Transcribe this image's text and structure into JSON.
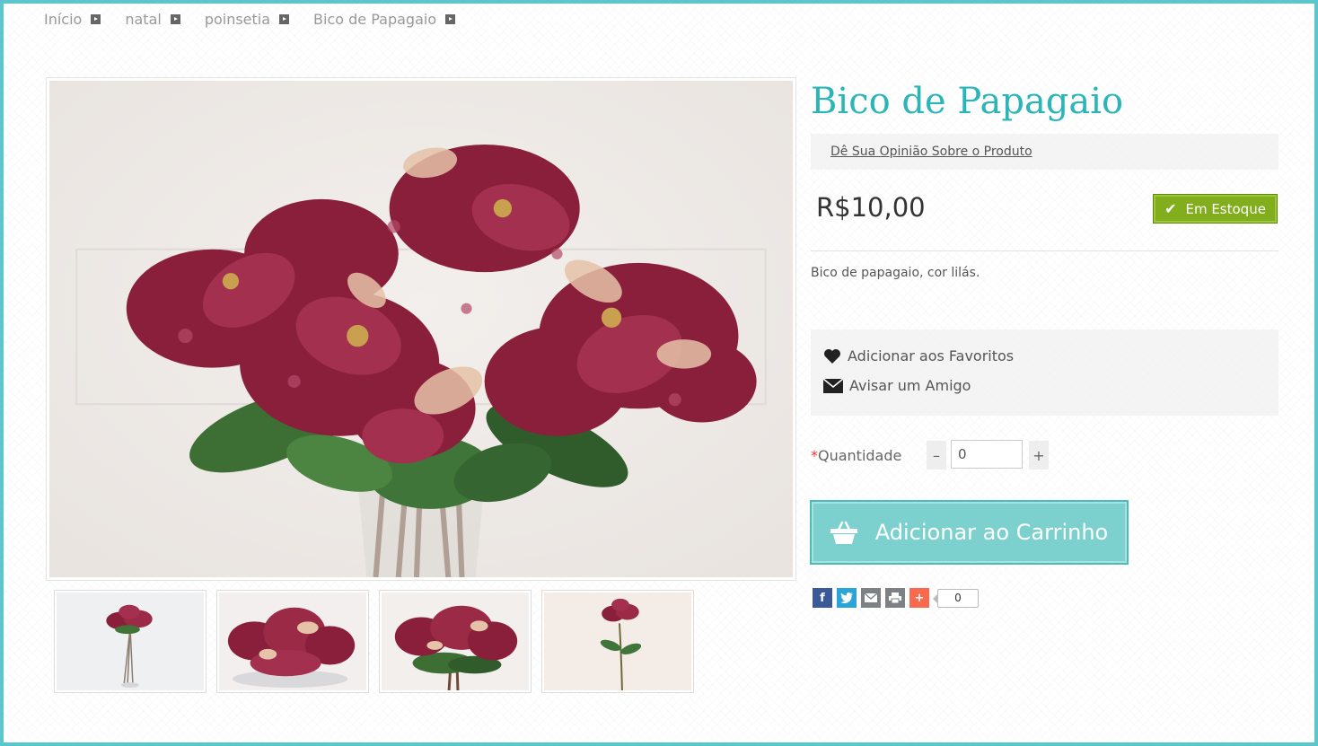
{
  "breadcrumb": {
    "items": [
      {
        "label": "Início"
      },
      {
        "label": "natal"
      },
      {
        "label": "poinsetia"
      },
      {
        "label": "Bico de Papagaio"
      }
    ]
  },
  "product": {
    "title": "Bico de Papagaio",
    "review_link": "Dê Sua Opinião Sobre o Produto",
    "price": "R$10,00",
    "stock_label": "Em Estoque",
    "description": "Bico de papagaio, cor lilás."
  },
  "actions": {
    "favorites": "Adicionar aos Favoritos",
    "tell_friend": "Avisar um Amigo"
  },
  "quantity": {
    "required_mark": "*",
    "label": "Quantidade",
    "minus": "–",
    "plus": "+",
    "value": "0"
  },
  "cart": {
    "button_label": "Adicionar ao Carrinho"
  },
  "share": {
    "count": "0"
  },
  "colors": {
    "accent": "#2cb5b8",
    "border": "#5bc7cc",
    "cart_button": "#7cd1cf",
    "stock_badge": "#82ae1d"
  }
}
